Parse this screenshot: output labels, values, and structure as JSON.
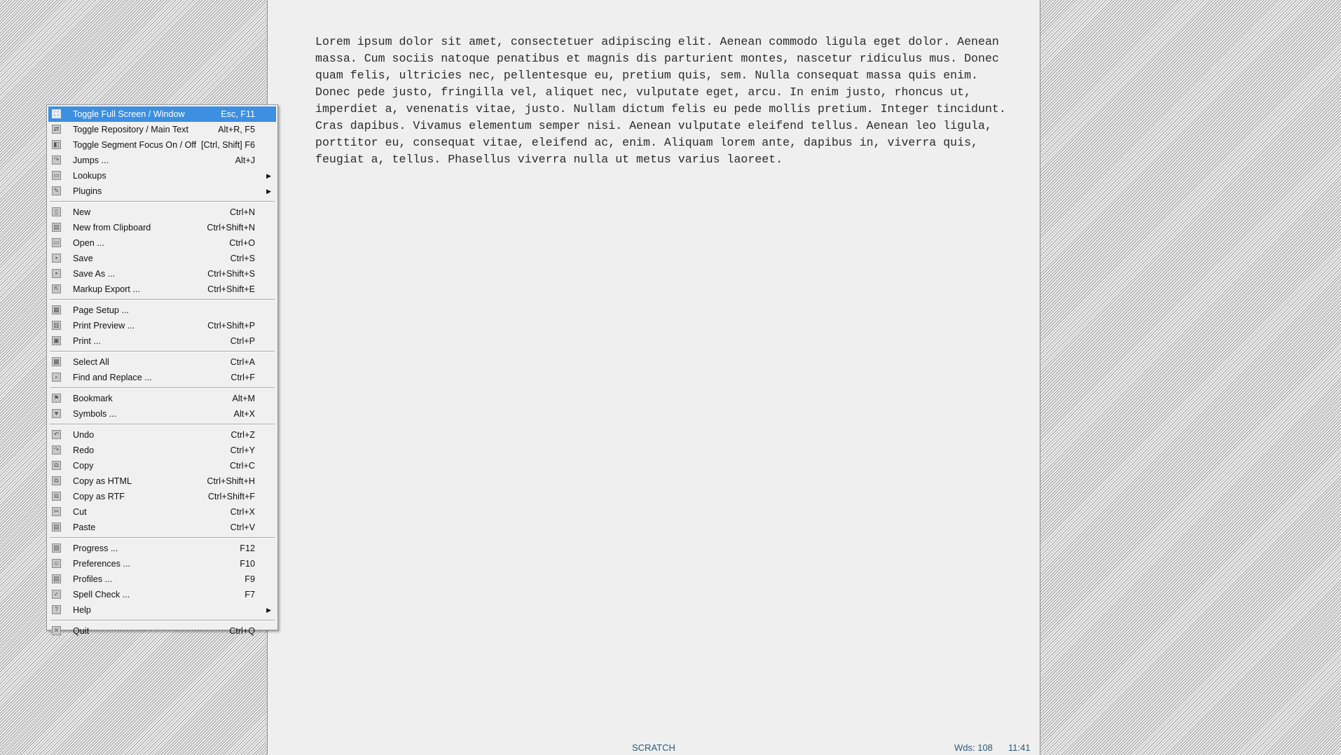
{
  "document": {
    "text": "Lorem ipsum dolor sit amet, consectetuer adipiscing elit. Aenean commodo ligula eget dolor. Aenean massa. Cum sociis natoque penatibus et magnis dis parturient montes, nascetur ridiculus mus. Donec quam felis, ultricies nec, pellentesque eu, pretium quis, sem. Nulla consequat massa quis enim. Donec pede justo, fringilla vel, aliquet nec, vulputate eget, arcu. In enim justo, rhoncus ut, imperdiet a, venenatis vitae, justo. Nullam dictum felis eu pede mollis pretium. Integer tincidunt. Cras dapibus. Vivamus elementum semper nisi. Aenean vulputate eleifend tellus. Aenean leo ligula, porttitor eu, consequat vitae, eleifend ac, enim. Aliquam lorem ante, dapibus in, viverra quis, feugiat a, tellus. Phasellus viverra nulla ut metus varius laoreet."
  },
  "status": {
    "mode": "SCRATCH",
    "words": "Wds: 108",
    "time": "11:41"
  },
  "colors": {
    "highlight": "#3c8fe1",
    "status_text": "#2a5a7a"
  },
  "menu": {
    "groups": [
      [
        {
          "label": "Toggle Full Screen / Window",
          "shortcut": "Esc, F11",
          "icon": "fullscreen-icon",
          "highlighted": true
        },
        {
          "label": "Toggle Repository / Main Text",
          "shortcut": "Alt+R, F5",
          "icon": "repository-icon"
        },
        {
          "label": "Toggle Segment Focus On / Off",
          "shortcut": "[Ctrl, Shift] F6",
          "icon": "segment-focus-icon"
        },
        {
          "label": "Jumps ...",
          "shortcut": "Alt+J",
          "icon": "jumps-icon"
        },
        {
          "label": "Lookups",
          "shortcut": "",
          "icon": "lookups-icon",
          "submenu": true
        },
        {
          "label": "Plugins",
          "shortcut": "",
          "icon": "plugins-icon",
          "submenu": true
        }
      ],
      [
        {
          "label": "New",
          "shortcut": "Ctrl+N",
          "icon": "new-file-icon"
        },
        {
          "label": "New from Clipboard",
          "shortcut": "Ctrl+Shift+N",
          "icon": "clipboard-icon"
        },
        {
          "label": "Open ...",
          "shortcut": "Ctrl+O",
          "icon": "open-folder-icon"
        },
        {
          "label": "Save",
          "shortcut": "Ctrl+S",
          "icon": "save-icon"
        },
        {
          "label": "Save As ...",
          "shortcut": "Ctrl+Shift+S",
          "icon": "save-as-icon"
        },
        {
          "label": "Markup Export ...",
          "shortcut": "Ctrl+Shift+E",
          "icon": "export-icon"
        }
      ],
      [
        {
          "label": "Page Setup ...",
          "shortcut": "",
          "icon": "page-setup-icon"
        },
        {
          "label": "Print Preview ...",
          "shortcut": "Ctrl+Shift+P",
          "icon": "print-preview-icon"
        },
        {
          "label": "Print ...",
          "shortcut": "Ctrl+P",
          "icon": "print-icon"
        }
      ],
      [
        {
          "label": "Select All",
          "shortcut": "Ctrl+A",
          "icon": "select-all-icon"
        },
        {
          "label": "Find and Replace ...",
          "shortcut": "Ctrl+F",
          "icon": "search-icon"
        }
      ],
      [
        {
          "label": "Bookmark",
          "shortcut": "Alt+M",
          "icon": "bookmark-icon"
        },
        {
          "label": "Symbols ...",
          "shortcut": "Alt+X",
          "icon": "symbols-icon"
        }
      ],
      [
        {
          "label": "Undo",
          "shortcut": "Ctrl+Z",
          "icon": "undo-icon"
        },
        {
          "label": "Redo",
          "shortcut": "Ctrl+Y",
          "icon": "redo-icon"
        },
        {
          "label": "Copy",
          "shortcut": "Ctrl+C",
          "icon": "copy-icon"
        },
        {
          "label": "Copy as HTML",
          "shortcut": "Ctrl+Shift+H",
          "icon": "copy-html-icon"
        },
        {
          "label": "Copy as RTF",
          "shortcut": "Ctrl+Shift+F",
          "icon": "copy-rtf-icon"
        },
        {
          "label": "Cut",
          "shortcut": "Ctrl+X",
          "icon": "cut-icon"
        },
        {
          "label": "Paste",
          "shortcut": "Ctrl+V",
          "icon": "paste-icon"
        }
      ],
      [
        {
          "label": "Progress ...",
          "shortcut": "F12",
          "icon": "progress-icon"
        },
        {
          "label": "Preferences ...",
          "shortcut": "F10",
          "icon": "preferences-icon"
        },
        {
          "label": "Profiles ...",
          "shortcut": "F9",
          "icon": "profiles-icon"
        },
        {
          "label": "Spell Check ...",
          "shortcut": "F7",
          "icon": "spell-check-icon"
        },
        {
          "label": "Help",
          "shortcut": "",
          "icon": "help-icon",
          "submenu": true
        }
      ],
      [
        {
          "label": "Quit",
          "shortcut": "Ctrl+Q",
          "icon": "quit-icon"
        }
      ]
    ]
  }
}
